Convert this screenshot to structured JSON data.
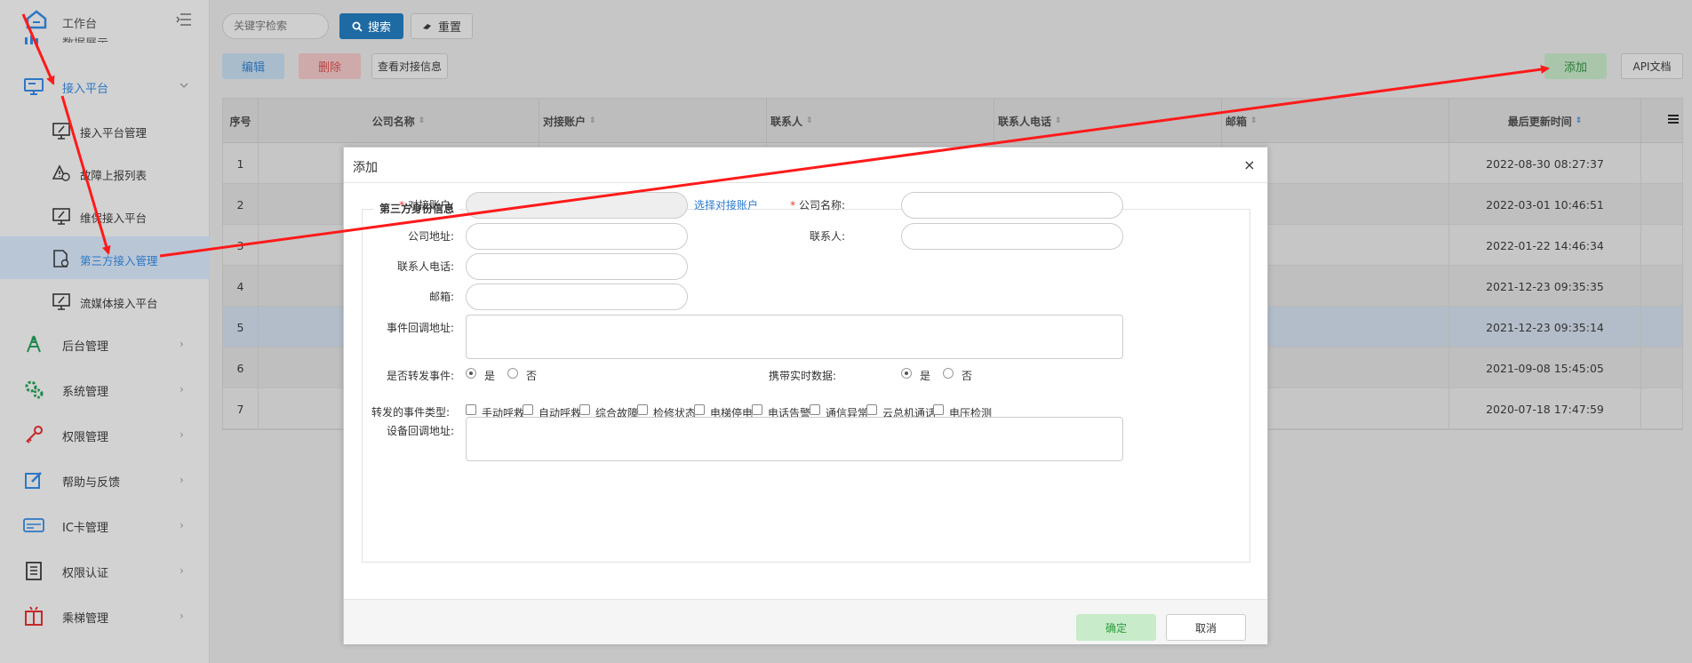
{
  "sidebar": {
    "title": "工作台",
    "cut_label": "数据展示",
    "section": {
      "label": "接入平台",
      "expanded": true
    },
    "subitems": [
      {
        "label": "接入平台管理"
      },
      {
        "label": "故障上报列表"
      },
      {
        "label": "维保接入平台"
      },
      {
        "label": "第三方接入管理",
        "active": true
      },
      {
        "label": "流媒体接入平台"
      }
    ],
    "items": [
      {
        "label": "后台管理",
        "icon": "tower-icon"
      },
      {
        "label": "系统管理",
        "icon": "gears-icon"
      },
      {
        "label": "权限管理",
        "icon": "key-icon"
      },
      {
        "label": "帮助与反馈",
        "icon": "edit-icon"
      },
      {
        "label": "IC卡管理",
        "icon": "card-icon"
      },
      {
        "label": "权限认证",
        "icon": "list-icon"
      },
      {
        "label": "乘梯管理",
        "icon": "elevator-icon"
      }
    ]
  },
  "toolbar": {
    "search_placeholder": "关键字检索",
    "search_label": "搜索",
    "reset_label": "重置",
    "edit_label": "编辑",
    "delete_label": "删除",
    "view_label": "查看对接信息",
    "add_label": "添加",
    "api_label": "API文档"
  },
  "table": {
    "headers": [
      "序号",
      "公司名称",
      "对接账户",
      "联系人",
      "联系人电话",
      "邮箱",
      "最后更新时间"
    ],
    "rows": [
      {
        "no": "1",
        "updated": "2022-08-30 08:27:37"
      },
      {
        "no": "2",
        "updated": "2022-03-01 10:46:51"
      },
      {
        "no": "3",
        "updated": "2022-01-22 14:46:34"
      },
      {
        "no": "4",
        "updated": "2021-12-23 09:35:35"
      },
      {
        "no": "5",
        "updated": "2021-12-23 09:35:14"
      },
      {
        "no": "6",
        "updated": "2021-09-08 15:45:05"
      },
      {
        "no": "7",
        "updated": "2020-07-18 17:47:59"
      }
    ]
  },
  "modal": {
    "title": "添加",
    "close": "×",
    "legend": "第三方身份信息",
    "account_label": "对接账户:",
    "account_link": "选择对接账户",
    "company_label": "公司名称:",
    "address_label": "公司地址:",
    "contact_label": "联系人:",
    "phone_label": "联系人电话:",
    "email_label": "邮箱:",
    "event_url_label": "事件回调地址:",
    "forward_label": "是否转发事件:",
    "realtime_label": "携带实时数据:",
    "yes": "是",
    "no": "否",
    "event_types_label": "转发的事件类型:",
    "event_types": [
      "手动呼救",
      "自动呼救",
      "综合故障",
      "检修状态",
      "电梯停电",
      "电话告警",
      "通信异常",
      "云总机通话",
      "电压检测"
    ],
    "device_url_label": "设备回调地址:",
    "ok_label": "确定",
    "cancel_label": "取消"
  },
  "colors": {
    "accent": "#2d77c4",
    "annotation_arrow": "#ff1a1a",
    "ok_green": "#2c9c3c"
  }
}
